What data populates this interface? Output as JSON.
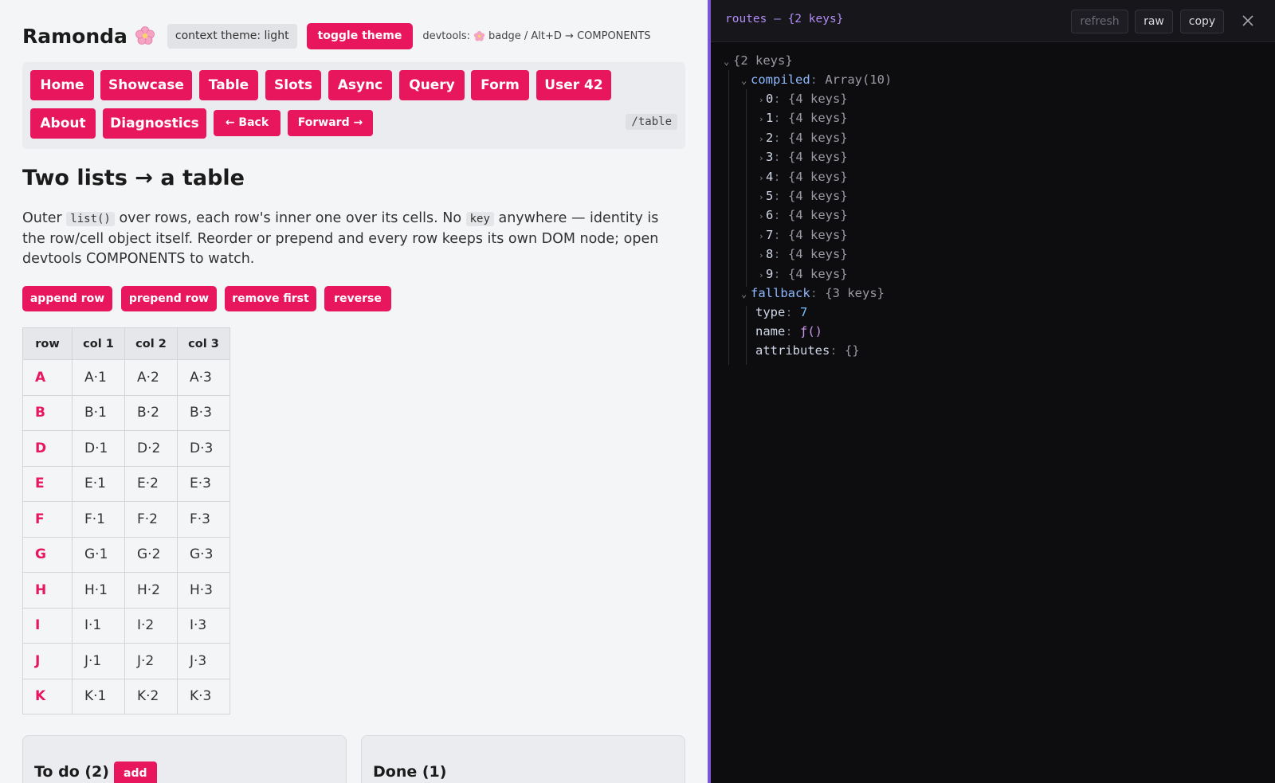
{
  "app": {
    "brand": "Ramonda",
    "theme_chip": "context theme: light",
    "toggle_theme": "toggle theme",
    "devtools_hint_prefix": "devtools:",
    "devtools_hint_suffix": "badge / Alt+D → COMPONENTS",
    "nav": {
      "links": [
        "Home",
        "Showcase",
        "Table",
        "Slots",
        "Async",
        "Query",
        "Form",
        "User 42",
        "About",
        "Diagnostics"
      ],
      "back": "← Back",
      "forward": "Forward →",
      "path": "/table"
    },
    "title": "Two lists → a table",
    "intro": {
      "p1": "Outer",
      "code1": "list()",
      "p2": "over rows, each row's inner one over its cells. No",
      "code2": "key",
      "p3": "anywhere — identity is the row/cell object itself. Reorder or prepend and every row keeps its own DOM node; open devtools COMPONENTS to watch."
    },
    "actions": [
      "append row",
      "prepend row",
      "remove first",
      "reverse"
    ],
    "table": {
      "headers": [
        "row",
        "col 1",
        "col 2",
        "col 3"
      ],
      "rows": [
        [
          "A",
          "A·1",
          "A·2",
          "A·3"
        ],
        [
          "B",
          "B·1",
          "B·2",
          "B·3"
        ],
        [
          "D",
          "D·1",
          "D·2",
          "D·3"
        ],
        [
          "E",
          "E·1",
          "E·2",
          "E·3"
        ],
        [
          "F",
          "F·1",
          "F·2",
          "F·3"
        ],
        [
          "G",
          "G·1",
          "G·2",
          "G·3"
        ],
        [
          "H",
          "H·1",
          "H·2",
          "H·3"
        ],
        [
          "I",
          "I·1",
          "I·2",
          "I·3"
        ],
        [
          "J",
          "J·1",
          "J·2",
          "J·3"
        ],
        [
          "K",
          "K·1",
          "K·2",
          "K·3"
        ]
      ]
    },
    "todo": {
      "title": "To do (2)",
      "add": "add"
    },
    "done": {
      "title": "Done (1)"
    }
  },
  "devtools": {
    "title": "routes — {2 keys}",
    "buttons": {
      "refresh": "refresh",
      "raw": "raw",
      "copy": "copy"
    },
    "root": "{2 keys}",
    "compiled": {
      "key": "compiled",
      "value": "Array(10)",
      "items": [
        "0",
        "1",
        "2",
        "3",
        "4",
        "5",
        "6",
        "7",
        "8",
        "9"
      ],
      "item_value": "{4 keys}"
    },
    "fallback": {
      "key": "fallback",
      "value": "{3 keys}",
      "props": [
        {
          "key": "type",
          "value": "7",
          "kind": "num"
        },
        {
          "key": "name",
          "value": "ƒ()",
          "kind": "fn"
        },
        {
          "key": "attributes",
          "value": "{}",
          "kind": "punct"
        }
      ]
    },
    "close_icon": "close-icon"
  },
  "colors": {
    "accent": "#e8175d",
    "devtools_border": "#7a55d8",
    "devtools_bg": "#0d0d0f"
  }
}
